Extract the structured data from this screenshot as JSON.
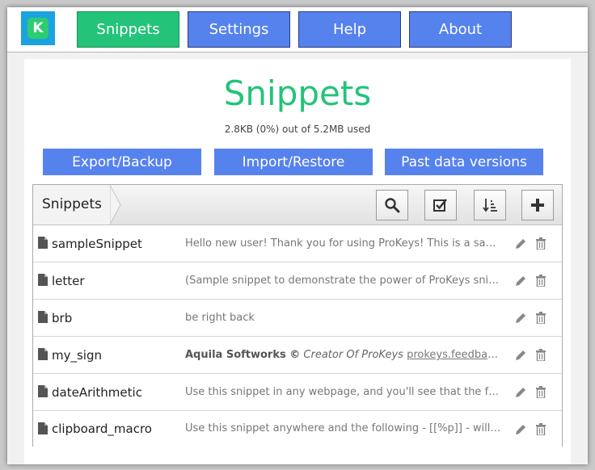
{
  "nav": {
    "logo_letter": "K",
    "items": [
      {
        "label": "Snippets",
        "active": true
      },
      {
        "label": "Settings",
        "active": false
      },
      {
        "label": "Help",
        "active": false
      },
      {
        "label": "About",
        "active": false
      }
    ]
  },
  "page": {
    "title": "Snippets",
    "usage": "2.8KB (0%) out of 5.2MB used"
  },
  "actions": {
    "export": "Export/Backup",
    "import": "Import/Restore",
    "past": "Past data versions"
  },
  "list": {
    "breadcrumb": "Snippets",
    "tools": [
      "search-icon",
      "checkbox-icon",
      "sort-icon",
      "plus-icon"
    ],
    "snippets": [
      {
        "name": "sampleSnippet",
        "preview": "Hello new user! Thank you for using ProKeys!  This is a sample snippet."
      },
      {
        "name": "letter",
        "preview": "(Sample snippet to demonstrate the power of ProKeys snippets)"
      },
      {
        "name": "brb",
        "preview": "be right back"
      },
      {
        "name": "my_sign",
        "preview_bold": "Aquila Softworks ©",
        "preview_italic": "Creator Of ProKeys",
        "preview_link": "prokeys.feedback@gmail.com"
      },
      {
        "name": "dateArithmetic",
        "preview": "Use this snippet in any webpage, and you'll see that the following"
      },
      {
        "name": "clipboard_macro",
        "preview": "Use this snippet anywhere and the following - [[%p]] - will be replaced"
      }
    ]
  },
  "colors": {
    "accent_green": "#24c37a",
    "accent_blue": "#5682ee"
  }
}
